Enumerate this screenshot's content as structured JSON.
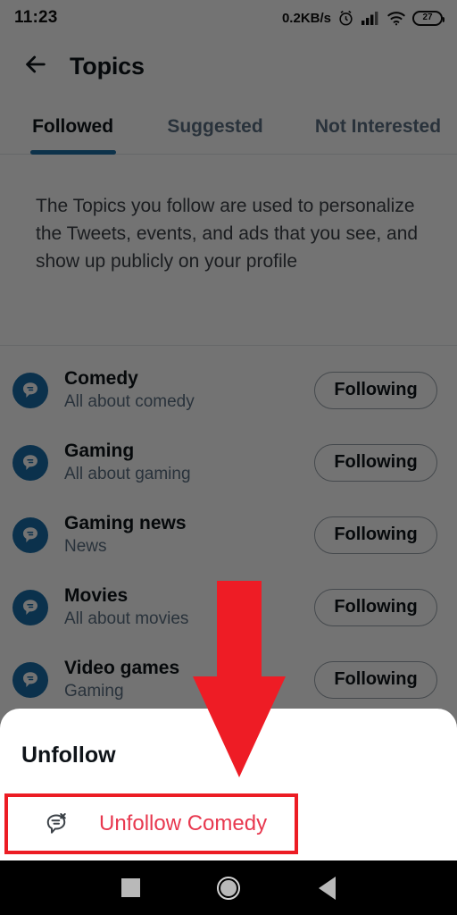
{
  "status_bar": {
    "time": "11:23",
    "network_speed": "0.2KB/s",
    "alarm_icon": "alarm-clock-icon",
    "signal_icon": "cellular-signal-icon",
    "wifi_icon": "wifi-icon",
    "battery_level": "27"
  },
  "app_bar": {
    "back_icon": "back-arrow-icon",
    "title": "Topics"
  },
  "tabs": [
    {
      "label": "Followed",
      "active": true
    },
    {
      "label": "Suggested",
      "active": false
    },
    {
      "label": "Not Interested",
      "active": false
    }
  ],
  "description": "The Topics you follow are used to personalize the Tweets, events, and ads that you see, and show up publicly on your profile",
  "topics": [
    {
      "name": "Comedy",
      "subtitle": "All about comedy",
      "button": "Following",
      "icon": "topic-bubble-icon"
    },
    {
      "name": "Gaming",
      "subtitle": "All about gaming",
      "button": "Following",
      "icon": "topic-bubble-icon"
    },
    {
      "name": "Gaming news",
      "subtitle": "News",
      "button": "Following",
      "icon": "topic-bubble-icon"
    },
    {
      "name": "Movies",
      "subtitle": "All about movies",
      "button": "Following",
      "icon": "topic-bubble-icon"
    },
    {
      "name": "Video games",
      "subtitle": "Gaming",
      "button": "Following",
      "icon": "topic-bubble-icon"
    }
  ],
  "bottom_sheet": {
    "title": "Unfollow",
    "action_label": "Unfollow Comedy",
    "action_icon": "unfollow-topic-icon"
  },
  "annotation": {
    "arrow_icon": "red-down-arrow",
    "arrow_color": "#ee1c25",
    "highlight_color": "#ec1c24"
  },
  "nav_bar": {
    "recents_icon": "recents-square-icon",
    "home_icon": "home-circle-icon",
    "back_icon": "back-triangle-icon"
  },
  "colors": {
    "accent_blue": "#1d6fa5",
    "topic_icon_blue": "#1a6ea8",
    "text_primary": "#0f1419",
    "text_secondary": "#5b7083",
    "unfollow_red": "#e8384f"
  }
}
